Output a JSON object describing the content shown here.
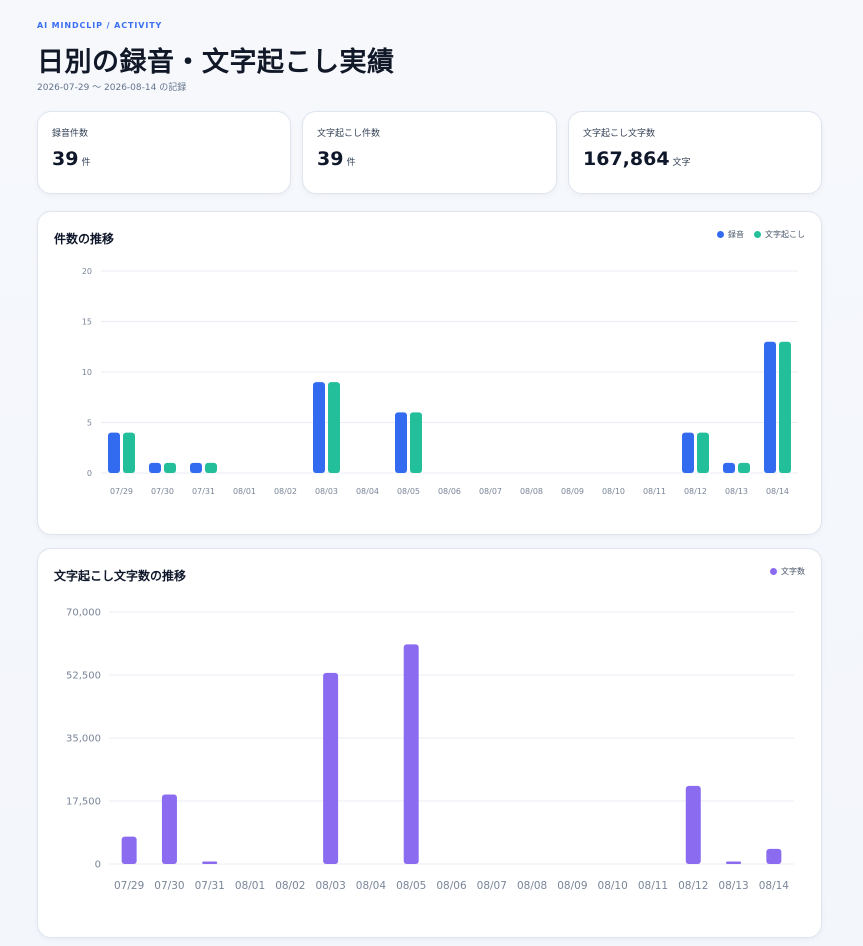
{
  "header": {
    "eyebrow": "AI MINDCLIP / ACTIVITY",
    "title": "日別の録音・文字起こし実績",
    "date_range": "2026-07-29 〜 2026-08-14 の記録"
  },
  "stats": [
    {
      "label": "録音件数",
      "value": "39",
      "unit": "件"
    },
    {
      "label": "文字起こし件数",
      "value": "39",
      "unit": "件"
    },
    {
      "label": "文字起こし文字数",
      "value": "167,864",
      "unit": "文字"
    }
  ],
  "colors": {
    "recording": "#326bf0",
    "transcription": "#22bf9a",
    "chars": "#8b6cf0",
    "grid": "#e8ecf3"
  },
  "chart_data": [
    {
      "type": "bar",
      "title": "件数の推移",
      "categories": [
        "07/29",
        "07/30",
        "07/31",
        "08/01",
        "08/02",
        "08/03",
        "08/04",
        "08/05",
        "08/06",
        "08/07",
        "08/08",
        "08/09",
        "08/10",
        "08/11",
        "08/12",
        "08/13",
        "08/14"
      ],
      "series": [
        {
          "name": "録音",
          "values": [
            4,
            1,
            1,
            0,
            0,
            9,
            0,
            6,
            0,
            0,
            0,
            0,
            0,
            0,
            4,
            1,
            13
          ]
        },
        {
          "name": "文字起こし",
          "values": [
            4,
            1,
            1,
            0,
            0,
            9,
            0,
            6,
            0,
            0,
            0,
            0,
            0,
            0,
            4,
            1,
            13
          ]
        }
      ],
      "yticks": [
        "0",
        "5",
        "10",
        "15",
        "20"
      ],
      "ylim": [
        0,
        20
      ],
      "grid": true,
      "legend": "top-right"
    },
    {
      "type": "bar",
      "title": "文字起こし文字数の推移",
      "categories": [
        "07/29",
        "07/30",
        "07/31",
        "08/01",
        "08/02",
        "08/03",
        "08/04",
        "08/05",
        "08/06",
        "08/07",
        "08/08",
        "08/09",
        "08/10",
        "08/11",
        "08/12",
        "08/13",
        "08/14"
      ],
      "series": [
        {
          "name": "文字数",
          "values": [
            7600,
            19300,
            700,
            0,
            0,
            53100,
            0,
            61000,
            0,
            0,
            0,
            0,
            0,
            0,
            21700,
            700,
            4200
          ]
        }
      ],
      "yticks": [
        "0",
        "17,500",
        "35,000",
        "52,500",
        "70,000"
      ],
      "ylim": [
        0,
        70000
      ],
      "grid": true,
      "legend": "top-right"
    }
  ]
}
